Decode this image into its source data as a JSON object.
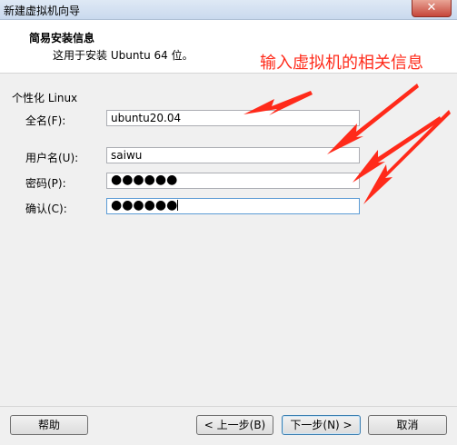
{
  "window": {
    "title": "新建虚拟机向导",
    "close_glyph": "✕"
  },
  "header": {
    "heading": "简易安装信息",
    "subheading": "这用于安装 Ubuntu 64 位。"
  },
  "annotation": {
    "text": "输入虚拟机的相关信息",
    "color": "#ff2a1a"
  },
  "form": {
    "group_label": "个性化 Linux",
    "fullname": {
      "label": "全名(F):",
      "value": "ubuntu20.04"
    },
    "username": {
      "label": "用户名(U):",
      "value": "saiwu"
    },
    "password": {
      "label": "密码(P):",
      "value": "●●●●●●"
    },
    "confirm": {
      "label": "确认(C):",
      "value": "●●●●●●"
    }
  },
  "buttons": {
    "help": "帮助",
    "back": "< 上一步(B)",
    "next": "下一步(N) >",
    "cancel": "取消"
  }
}
